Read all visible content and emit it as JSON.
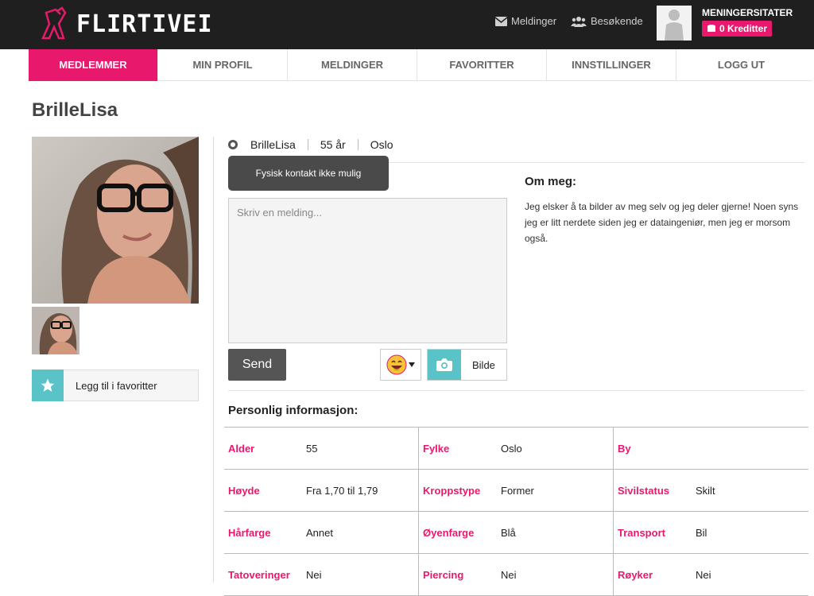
{
  "header": {
    "logo_text": "FLIRTIVEI",
    "messages_label": "Meldinger",
    "visitors_label": "Besøkende",
    "username": "MENINGERSITATER",
    "credits_label": "0 Kreditter"
  },
  "nav": {
    "items": [
      {
        "label": "MEDLEMMER"
      },
      {
        "label": "MIN PROFIL"
      },
      {
        "label": "MELDINGER"
      },
      {
        "label": "FAVORITTER"
      },
      {
        "label": "INNSTILLINGER"
      },
      {
        "label": "LOGG UT"
      }
    ]
  },
  "profile": {
    "name": "BrilleLisa",
    "age": "55 år",
    "city": "Oslo",
    "favorite_label": "Legg til i favoritter"
  },
  "message": {
    "tooltip": "Fysisk kontakt ikke mulig",
    "placeholder": "Skriv en melding...",
    "send_label": "Send",
    "photo_label": "Bilde"
  },
  "about": {
    "title": "Om meg:",
    "text": "Jeg elsker å ta bilder av meg selv og jeg deler gjerne! Noen syns jeg er litt nerdete siden jeg er dataingeniør, men jeg er morsom også."
  },
  "personal_info": {
    "title": "Personlig informasjon:",
    "rows": [
      [
        {
          "label": "Alder",
          "value": "55"
        },
        {
          "label": "Fylke",
          "value": "Oslo"
        },
        {
          "label": "By",
          "value": ""
        }
      ],
      [
        {
          "label": "Høyde",
          "value": "Fra 1,70 til 1,79"
        },
        {
          "label": "Kroppstype",
          "value": "Former"
        },
        {
          "label": "Sivilstatus",
          "value": "Skilt"
        }
      ],
      [
        {
          "label": "Hårfarge",
          "value": "Annet"
        },
        {
          "label": "Øyenfarge",
          "value": "Blå"
        },
        {
          "label": "Transport",
          "value": "Bil"
        }
      ],
      [
        {
          "label": "Tatoveringer",
          "value": "Nei"
        },
        {
          "label": "Piercing",
          "value": "Nei"
        },
        {
          "label": "Røyker",
          "value": "Nei"
        }
      ]
    ]
  },
  "colors": {
    "accent": "#e8196d",
    "teal": "#5ac3c8",
    "topbar": "#1f1f1f"
  }
}
